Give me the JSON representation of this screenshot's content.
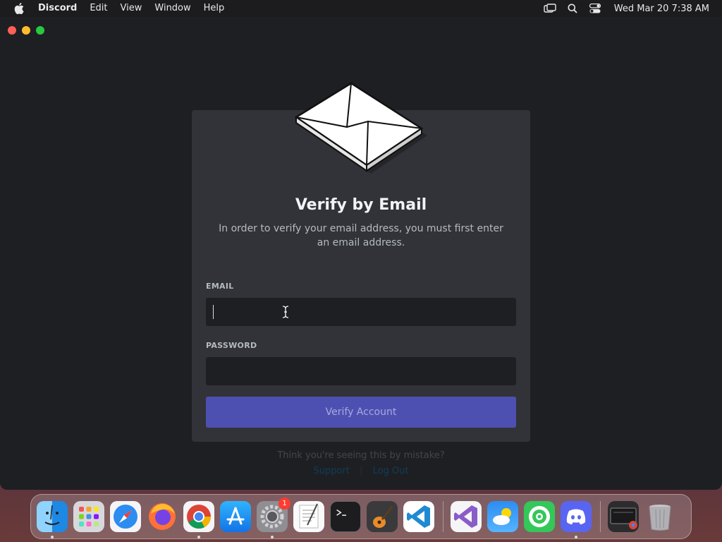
{
  "menubar": {
    "app_name": "Discord",
    "menus": [
      "Edit",
      "View",
      "Window",
      "Help"
    ],
    "clock": "Wed Mar 20  7:38 AM",
    "icons": [
      "apple-icon",
      "screen-mirroring-icon",
      "spotlight-search-icon",
      "control-center-icon"
    ]
  },
  "window": {
    "traffic_lights": [
      "close",
      "minimize",
      "zoom"
    ]
  },
  "dialog": {
    "title": "Verify by Email",
    "subtitle": "In order to verify your email address, you must first enter an email address.",
    "email_label": "EMAIL",
    "email_value": "",
    "password_label": "PASSWORD",
    "password_value": "",
    "button_label": "Verify Account",
    "footer_text": "Think you're seeing this by mistake?",
    "footer_links": [
      "Support",
      "Log Out"
    ]
  },
  "dock": {
    "apps": [
      {
        "name": "Finder",
        "icon": "finder-icon",
        "running": true
      },
      {
        "name": "Launchpad",
        "icon": "launchpad-icon",
        "running": false
      },
      {
        "name": "Safari",
        "icon": "safari-icon",
        "running": false
      },
      {
        "name": "Firefox",
        "icon": "firefox-icon",
        "running": false
      },
      {
        "name": "Google Chrome",
        "icon": "chrome-icon",
        "running": true
      },
      {
        "name": "App Store",
        "icon": "app-store-icon",
        "running": false
      },
      {
        "name": "System Settings",
        "icon": "settings-icon",
        "running": true,
        "badge": "1"
      },
      {
        "name": "TextEdit",
        "icon": "textedit-icon",
        "running": false
      },
      {
        "name": "Terminal",
        "icon": "terminal-icon",
        "running": false
      },
      {
        "name": "GarageBand",
        "icon": "garageband-icon",
        "running": false
      },
      {
        "name": "Visual Studio Code",
        "icon": "vscode-icon",
        "running": false
      },
      {
        "name": "Visual Studio",
        "icon": "visual-studio-icon",
        "running": false
      },
      {
        "name": "iCloud Weather",
        "icon": "weather-icon",
        "running": false
      },
      {
        "name": "Find My",
        "icon": "findmy-icon",
        "running": false
      },
      {
        "name": "Discord",
        "icon": "discord-icon",
        "running": true
      },
      {
        "name": "Downloads",
        "icon": "downloads-stack-icon",
        "running": false
      },
      {
        "name": "Trash",
        "icon": "trash-icon",
        "running": false
      }
    ]
  }
}
